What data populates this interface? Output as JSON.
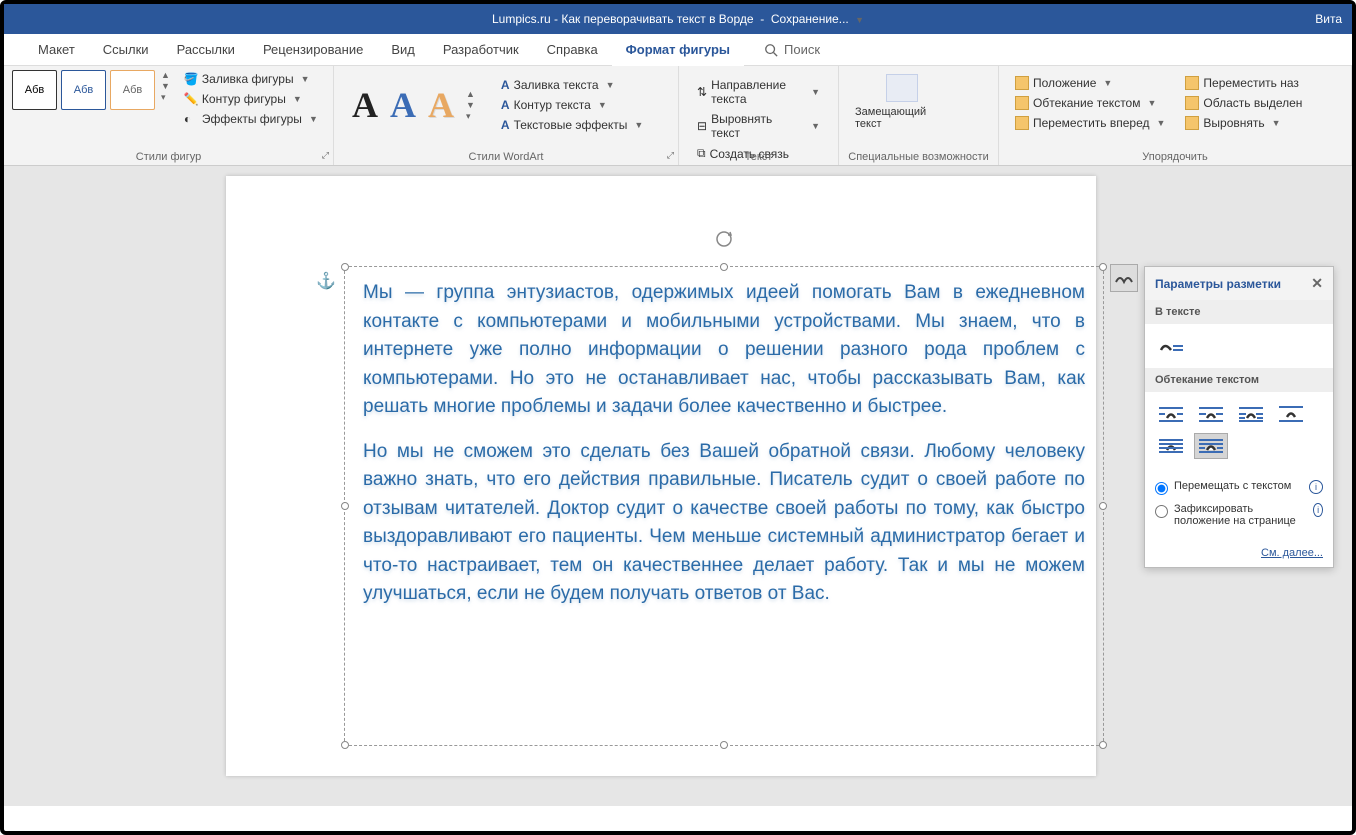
{
  "title": {
    "site": "Lumpics.ru",
    "doc": "Как переворачивать текст в Ворде",
    "status": "Сохранение...",
    "user": "Вита"
  },
  "tabs": {
    "layout": "Макет",
    "references": "Ссылки",
    "mailings": "Рассылки",
    "review": "Рецензирование",
    "view": "Вид",
    "developer": "Разработчик",
    "help": "Справка",
    "shapeformat": "Формат фигуры",
    "search": "Поиск"
  },
  "ribbon": {
    "shape_styles_label": "Стили фигур",
    "sample_text": "Абв",
    "shape_fill": "Заливка фигуры",
    "shape_outline": "Контур фигуры",
    "shape_effects": "Эффекты фигуры",
    "wordart_label": "Стили WordArt",
    "text_fill": "Заливка текста",
    "text_outline": "Контур текста",
    "text_effects": "Текстовые эффекты",
    "text_label": "Текст",
    "text_direction": "Направление текста",
    "align_text": "Выровнять текст",
    "create_link": "Создать связь",
    "accessibility_label": "Специальные возможности",
    "alt_text": "Замещающий текст",
    "arrange_label": "Упорядочить",
    "position": "Положение",
    "wrap_text": "Обтекание текстом",
    "bring_forward": "Переместить вперед",
    "send_backward": "Переместить наз",
    "selection_pane": "Область выделен",
    "align": "Выровнять"
  },
  "document": {
    "p1": "Мы — группа энтузиастов, одержимых идеей помогать Вам в ежедневном контакте с компьютерами и мобильными устройствами. Мы знаем, что в интернете уже полно информации о решении разного рода проблем с компьютерами. Но это не останавливает нас, чтобы рассказывать Вам, как решать многие проблемы и задачи более качественно и быстрее.",
    "p2": "Но мы не сможем это сделать без Вашей обратной связи. Любому человеку важно знать, что его действия правильные. Писатель судит о своей работе по отзывам читателей. Доктор судит о качестве своей работы по тому, как быстро выздоравливают его пациенты. Чем меньше системный администратор бегает и что-то настраивает, тем он качественнее делает работу. Так и мы не можем улучшаться, если не будем получать ответов от Вас."
  },
  "layout_panel": {
    "title": "Параметры разметки",
    "inline": "В тексте",
    "wrap": "Обтекание текстом",
    "move_with_text": "Перемещать с текстом",
    "fix_position": "Зафиксировать положение на странице",
    "see_more": "См. далее..."
  }
}
